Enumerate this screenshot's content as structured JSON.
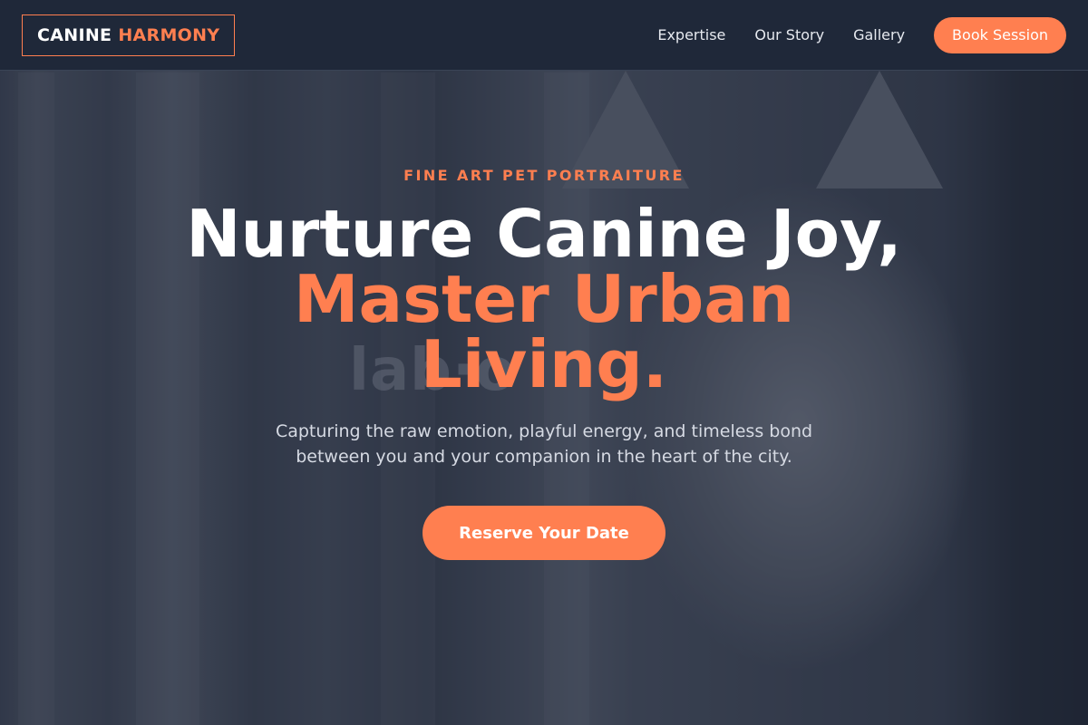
{
  "brand": {
    "name_part1": "CANINE",
    "name_part2": "HARMONY",
    "accent_color": "#ff7f50"
  },
  "nav": {
    "links": [
      {
        "label": "Expertise"
      },
      {
        "label": "Our Story"
      },
      {
        "label": "Gallery"
      }
    ],
    "cta_label": "Book Session"
  },
  "hero": {
    "background": "tabby-cat-photo",
    "eyebrow": "FINE ART PET PORTRAITURE",
    "headline_line1": "Nurture Canine Joy,",
    "headline_accent_line1": "Master Urban",
    "headline_accent_line2": "Living.",
    "subtext": "Capturing the raw emotion, playful energy, and timeless bond between you and your companion in the heart of the city.",
    "cta_label": "Reserve Your Date"
  }
}
